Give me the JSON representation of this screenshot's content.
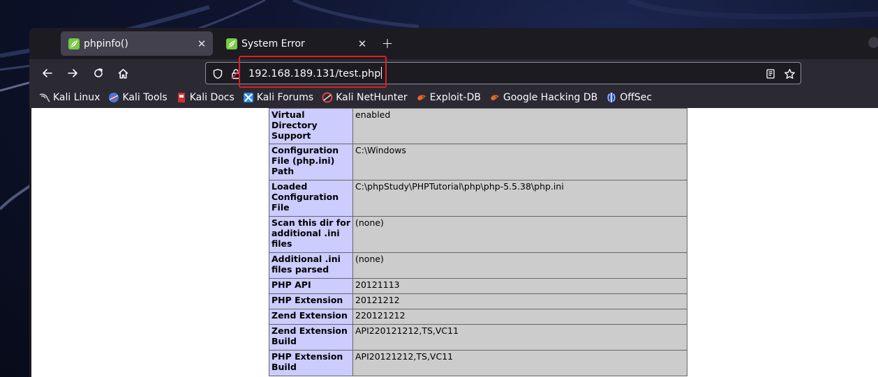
{
  "tabs": [
    {
      "title": "phpinfo()",
      "active": true
    },
    {
      "title": "System Error",
      "active": false
    }
  ],
  "url": "192.168.189.131/test.php",
  "bookmarks": [
    {
      "label": "Kali Linux",
      "icon": "kali-dragon-icon"
    },
    {
      "label": "Kali Tools",
      "icon": "kali-tools-icon"
    },
    {
      "label": "Kali Docs",
      "icon": "kali-docs-icon"
    },
    {
      "label": "Kali Forums",
      "icon": "kali-forums-icon"
    },
    {
      "label": "Kali NetHunter",
      "icon": "kali-nethunter-icon"
    },
    {
      "label": "Exploit-DB",
      "icon": "exploit-db-icon"
    },
    {
      "label": "Google Hacking DB",
      "icon": "ghdb-icon"
    },
    {
      "label": "OffSec",
      "icon": "offsec-icon"
    }
  ],
  "phpinfo_rows": [
    {
      "key": "Virtual Directory Support",
      "value": "enabled"
    },
    {
      "key": "Configuration File (php.ini) Path",
      "value": "C:\\Windows"
    },
    {
      "key": "Loaded Configuration File",
      "value": "C:\\phpStudy\\PHPTutorial\\php\\php-5.5.38\\php.ini"
    },
    {
      "key": "Scan this dir for additional .ini files",
      "value": "(none)"
    },
    {
      "key": "Additional .ini files parsed",
      "value": "(none)"
    },
    {
      "key": "PHP API",
      "value": "20121113"
    },
    {
      "key": "PHP Extension",
      "value": "20121212"
    },
    {
      "key": "Zend Extension",
      "value": "220121212"
    },
    {
      "key": "Zend Extension Build",
      "value": "API220121212,TS,VC11"
    },
    {
      "key": "PHP Extension Build",
      "value": "API20121212,TS,VC11"
    }
  ],
  "colors": {
    "key_cell": "#ccccff",
    "value_cell": "#cccccc",
    "highlight_box": "#e0201c",
    "tab_favicon": "#7ac943"
  }
}
